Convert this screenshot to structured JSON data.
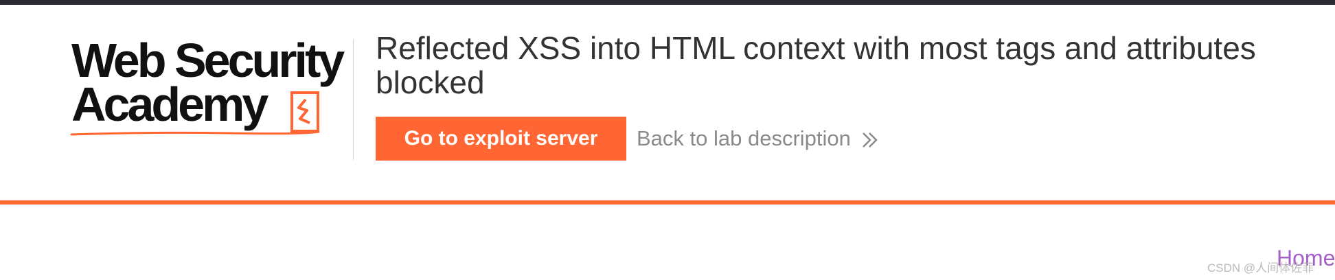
{
  "brand": {
    "logo_line1": "Web Security",
    "logo_line2": "Academy",
    "accent_color": "#ff6633",
    "logo_mark_icon": "lightning-badge-icon"
  },
  "lab": {
    "title": "Reflected XSS into HTML context with most tags and attributes blocked",
    "exploit_button_label": "Go to exploit server",
    "back_link_label": "Back to lab description",
    "back_link_icon": "double-chevron-right-icon"
  },
  "nav": {
    "home_label": "Home",
    "home_color": "#a45fc8"
  },
  "watermark": {
    "text": "CSDN @人间体佐菲"
  }
}
